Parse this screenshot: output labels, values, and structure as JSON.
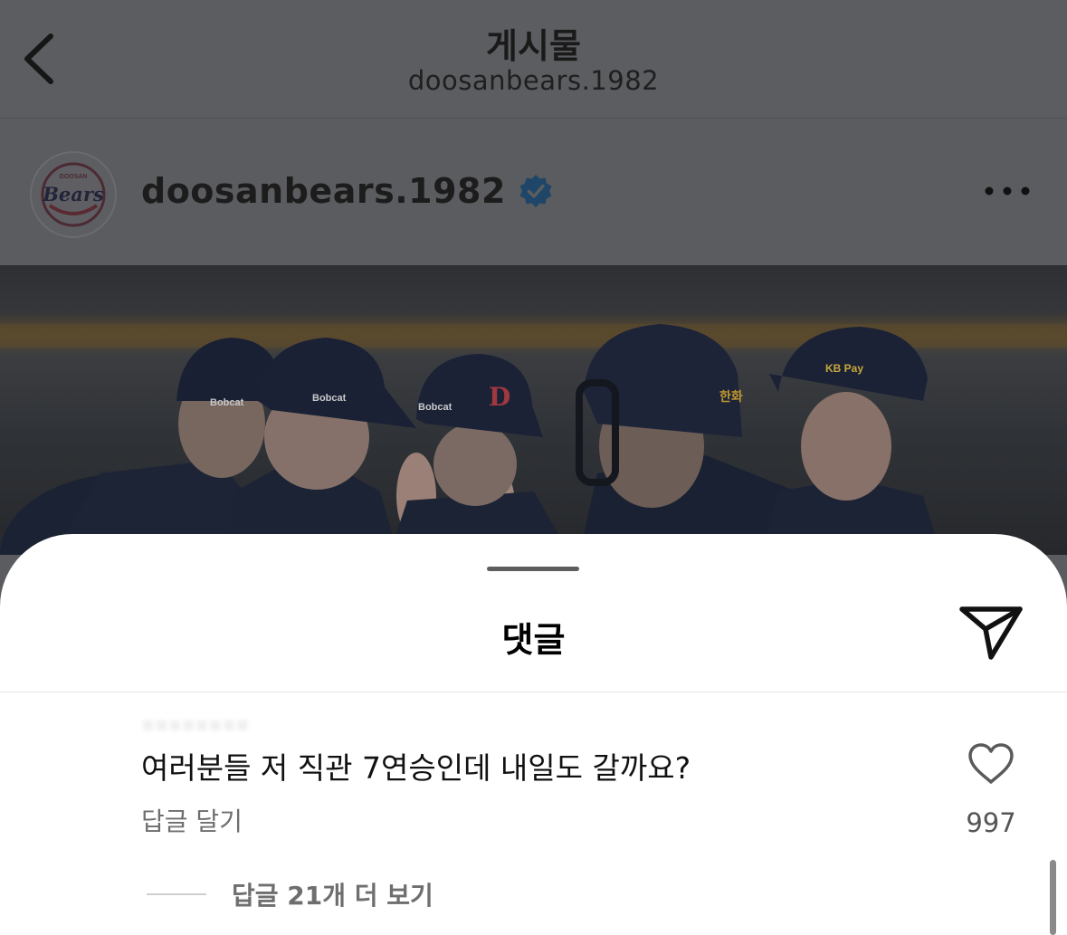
{
  "header": {
    "title": "게시물",
    "subtitle": "doosanbears.1982"
  },
  "post": {
    "username": "doosanbears.1982",
    "avatar_text": "Bears",
    "avatar_ring_text": "DOOSAN",
    "photo_texts": {
      "cap_sponsor_1": "Bobcat",
      "cap_sponsor_2": "Bobcat",
      "cap_sponsor_3": "Bobcat",
      "cap_logo": "D",
      "catcher_sponsor": "한화",
      "cap_sponsor_4": "KB Pay"
    }
  },
  "comments_sheet": {
    "title": "댓글",
    "comment": {
      "username": "▪▪▪▪▪▪▪▪",
      "text": "여러분들 저 직관 7연승인데 내일도 갈까요?",
      "reply_label": "답글 달기",
      "like_count": "997",
      "more_replies_label": "답글 21개 더 보기"
    }
  },
  "icons": {
    "back": "chevron-left-icon",
    "verified": "verified-badge-icon",
    "more": "more-horizontal-icon",
    "share": "paper-plane-icon",
    "like": "heart-icon"
  },
  "colors": {
    "verified_blue": "#3897f0",
    "overlay_gray": "#5b5c5f",
    "sheet_bg": "#ffffff"
  }
}
